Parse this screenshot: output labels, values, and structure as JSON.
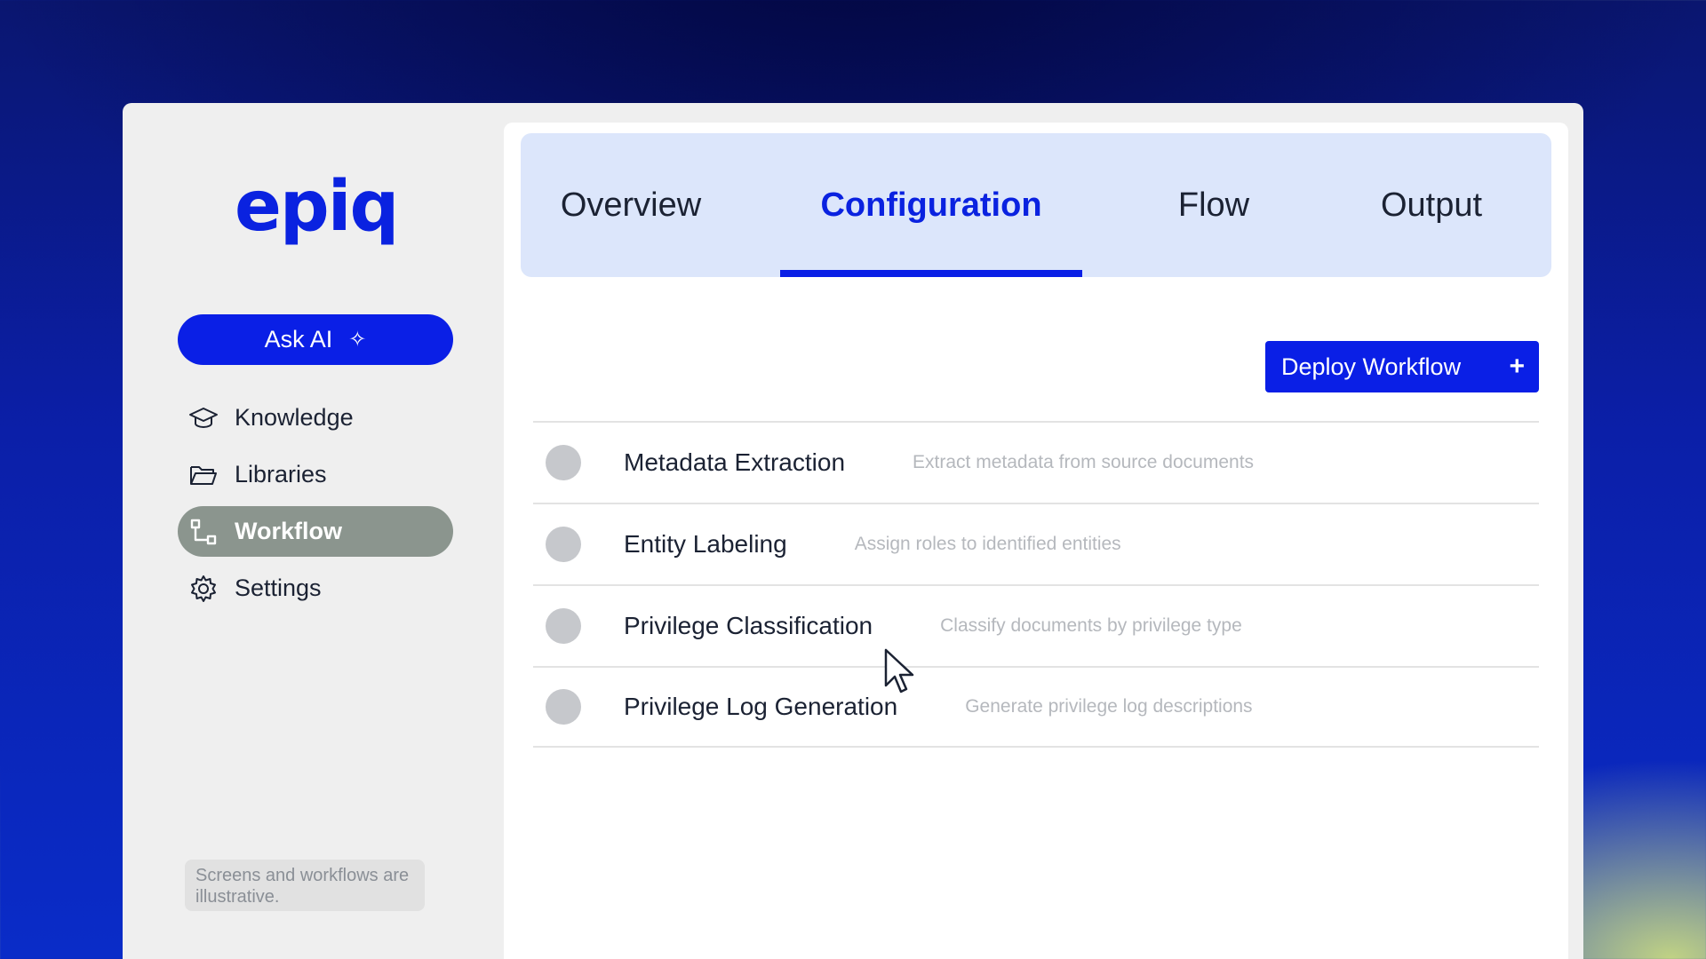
{
  "app": {
    "logo": "epiq"
  },
  "sidebar": {
    "ask_ai": {
      "label": "Ask AI",
      "icon": "sparkle-icon"
    },
    "items": [
      {
        "label": "Knowledge",
        "icon": "graduation-cap-icon",
        "active": false
      },
      {
        "label": "Libraries",
        "icon": "folder-open-icon",
        "active": false
      },
      {
        "label": "Workflow",
        "icon": "workflow-icon",
        "active": true
      },
      {
        "label": "Settings",
        "icon": "gear-icon",
        "active": false
      }
    ],
    "disclaimer": "Screens and workflows are illustrative."
  },
  "tabs": [
    {
      "label": "Overview",
      "active": false
    },
    {
      "label": "Configuration",
      "active": true
    },
    {
      "label": "Flow",
      "active": false
    },
    {
      "label": "Output",
      "active": false
    }
  ],
  "deploy": {
    "label": "Deploy Workflow",
    "icon": "plus-icon"
  },
  "steps": [
    {
      "name": "Metadata Extraction",
      "description": "Extract metadata from source documents"
    },
    {
      "name": "Entity Labeling",
      "description": "Assign roles to identified entities"
    },
    {
      "name": "Privilege Classification",
      "description": "Classify documents by privilege type"
    },
    {
      "name": "Privilege Log Generation",
      "description": "Generate privilege log descriptions"
    }
  ],
  "colors": {
    "accent": "#0a1fe6",
    "active_nav": "#8b958e",
    "tabbar": "#dce6fb"
  }
}
